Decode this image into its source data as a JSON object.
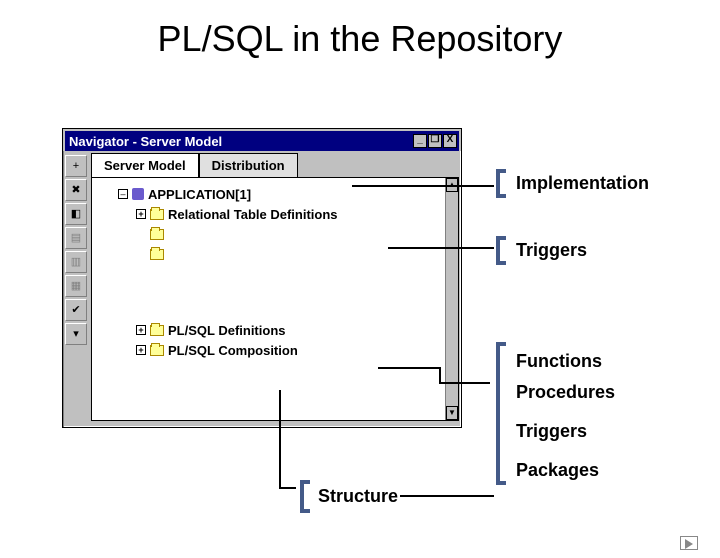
{
  "slide": {
    "title": "PL/SQL in the Repository"
  },
  "window": {
    "title": "Navigator - Server Model",
    "controls": {
      "min": "_",
      "restore": "❐",
      "close": "X"
    },
    "tabs": {
      "primary": "Server Model",
      "secondary": "Distribution"
    },
    "tree": {
      "app": "APPLICATION[1]",
      "rel": "Relational Table Definitions",
      "plsqldef": "PL/SQL Definitions",
      "plsqlcomp": "PL/SQL Composition"
    }
  },
  "labels": {
    "implementation": "Implementation",
    "triggers": "Triggers",
    "functions": "Functions",
    "procedures": "Procedures",
    "triggers2": "Triggers",
    "packages": "Packages",
    "structure": "Structure"
  }
}
